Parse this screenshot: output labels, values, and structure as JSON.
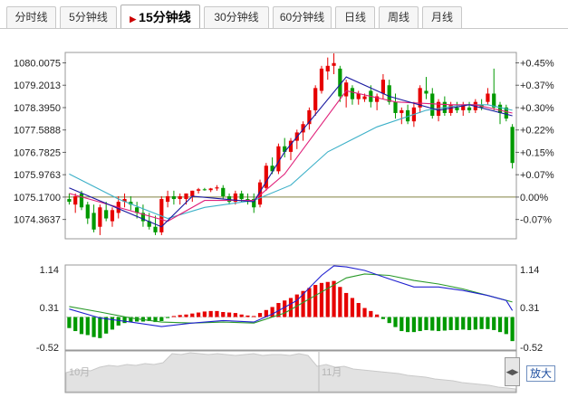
{
  "tabs": [
    {
      "label": "分时线",
      "active": false
    },
    {
      "label": "5分钟线",
      "active": false
    },
    {
      "label": "15分钟线",
      "active": true
    },
    {
      "label": "30分钟线",
      "active": false
    },
    {
      "label": "60分钟线",
      "active": false
    },
    {
      "label": "日线",
      "active": false
    },
    {
      "label": "周线",
      "active": false
    },
    {
      "label": "月线",
      "active": false
    }
  ],
  "zoom_label": "放大",
  "colors": {
    "up": "#e60000",
    "down": "#009900",
    "ma5": "#1a1aa0",
    "ma10": "#e0207a",
    "ma20": "#3cb0c8",
    "dif": "#2020d0",
    "dea": "#2a9a2a"
  },
  "chart_data": {
    "type": "candlestick",
    "price_axis": {
      "ylim": [
        1073.7,
        1080.35
      ],
      "left_ticks": [
        "1080.0075",
        "1079.2013",
        "1078.3950",
        "1077.5888",
        "1076.7825",
        "1075.9763",
        "1075.1700",
        "1074.3637"
      ],
      "right_ticks": [
        "+0.45%",
        "+0.37%",
        "+0.30%",
        "+0.22%",
        "+0.15%",
        "+0.07%",
        "0.00%",
        "-0.07%"
      ],
      "reference": 1075.17
    },
    "candles": [
      [
        1075.1,
        1075.3,
        1074.9,
        1075.0
      ],
      [
        1074.9,
        1075.3,
        1074.6,
        1075.2
      ],
      [
        1075.3,
        1075.4,
        1074.7,
        1074.8
      ],
      [
        1074.9,
        1075.0,
        1074.2,
        1074.4
      ],
      [
        1074.6,
        1074.9,
        1073.9,
        1074.0
      ],
      [
        1074.1,
        1074.9,
        1073.8,
        1074.8
      ],
      [
        1074.7,
        1075.0,
        1074.3,
        1074.4
      ],
      [
        1074.3,
        1074.8,
        1074.1,
        1074.7
      ],
      [
        1074.6,
        1075.2,
        1074.4,
        1075.0
      ],
      [
        1075.0,
        1075.3,
        1074.8,
        1075.1
      ],
      [
        1075.0,
        1075.2,
        1074.7,
        1074.9
      ],
      [
        1074.8,
        1075.0,
        1074.4,
        1074.6
      ],
      [
        1074.6,
        1074.9,
        1074.1,
        1074.3
      ],
      [
        1074.3,
        1074.6,
        1074.0,
        1074.1
      ],
      [
        1074.1,
        1074.5,
        1073.8,
        1073.9
      ],
      [
        1073.9,
        1075.2,
        1073.8,
        1075.1
      ],
      [
        1075.0,
        1075.4,
        1074.8,
        1075.2
      ],
      [
        1075.2,
        1075.4,
        1074.9,
        1075.1
      ],
      [
        1075.1,
        1075.3,
        1074.9,
        1075.2
      ],
      [
        1075.1,
        1075.3,
        1074.9,
        1075.3
      ],
      [
        1075.2,
        1075.4,
        1075.0,
        1075.4
      ],
      [
        1075.4,
        1075.5,
        1075.3,
        1075.45
      ],
      [
        1075.45,
        1075.5,
        1075.4,
        1075.42
      ],
      [
        1075.42,
        1075.5,
        1075.35,
        1075.48
      ],
      [
        1075.48,
        1075.6,
        1075.4,
        1075.52
      ],
      [
        1075.5,
        1075.6,
        1075.1,
        1075.2
      ],
      [
        1075.2,
        1075.3,
        1074.9,
        1075.0
      ],
      [
        1075.0,
        1075.4,
        1074.9,
        1075.3
      ],
      [
        1075.3,
        1075.4,
        1075.0,
        1075.1
      ],
      [
        1075.1,
        1075.3,
        1074.9,
        1075.0
      ],
      [
        1075.1,
        1075.3,
        1074.6,
        1074.8
      ],
      [
        1074.9,
        1075.8,
        1074.8,
        1075.7
      ],
      [
        1075.5,
        1076.4,
        1075.4,
        1076.3
      ],
      [
        1076.3,
        1076.6,
        1076.0,
        1076.1
      ],
      [
        1076.1,
        1077.1,
        1076.0,
        1077.0
      ],
      [
        1077.0,
        1077.3,
        1076.6,
        1076.8
      ],
      [
        1076.8,
        1077.3,
        1076.5,
        1077.2
      ],
      [
        1077.2,
        1077.6,
        1076.9,
        1077.5
      ],
      [
        1077.5,
        1077.9,
        1077.2,
        1077.8
      ],
      [
        1077.8,
        1078.4,
        1077.6,
        1078.3
      ],
      [
        1078.3,
        1079.2,
        1078.1,
        1079.1
      ],
      [
        1079.0,
        1079.9,
        1078.9,
        1079.8
      ],
      [
        1079.7,
        1080.2,
        1079.4,
        1079.9
      ],
      [
        1079.9,
        1080.35,
        1079.6,
        1080.0
      ],
      [
        1079.8,
        1079.9,
        1078.6,
        1078.8
      ],
      [
        1078.8,
        1079.4,
        1078.4,
        1079.3
      ],
      [
        1079.1,
        1079.2,
        1078.5,
        1078.7
      ],
      [
        1078.7,
        1079.0,
        1078.5,
        1078.9
      ],
      [
        1078.7,
        1078.9,
        1078.6,
        1078.8
      ],
      [
        1079.0,
        1079.2,
        1078.4,
        1078.6
      ],
      [
        1078.6,
        1078.9,
        1078.3,
        1078.8
      ],
      [
        1078.9,
        1079.6,
        1078.7,
        1079.4
      ],
      [
        1079.2,
        1079.4,
        1078.5,
        1078.6
      ],
      [
        1078.6,
        1078.9,
        1078.0,
        1078.2
      ],
      [
        1078.2,
        1078.4,
        1077.8,
        1078.3
      ],
      [
        1078.3,
        1078.5,
        1077.8,
        1077.9
      ],
      [
        1077.9,
        1078.6,
        1077.7,
        1078.4
      ],
      [
        1078.4,
        1079.2,
        1078.2,
        1079.1
      ],
      [
        1079.0,
        1079.5,
        1078.7,
        1078.9
      ],
      [
        1078.9,
        1079.1,
        1078.0,
        1078.1
      ],
      [
        1078.1,
        1078.7,
        1077.9,
        1078.6
      ],
      [
        1078.6,
        1078.8,
        1078.1,
        1078.2
      ],
      [
        1078.2,
        1078.6,
        1078.1,
        1078.5
      ],
      [
        1078.4,
        1078.6,
        1078.2,
        1078.3
      ],
      [
        1078.3,
        1078.6,
        1078.1,
        1078.5
      ],
      [
        1078.4,
        1078.6,
        1078.2,
        1078.3
      ],
      [
        1078.3,
        1078.7,
        1078.2,
        1078.6
      ],
      [
        1078.5,
        1078.7,
        1078.3,
        1078.4
      ],
      [
        1078.6,
        1079.1,
        1078.5,
        1078.9
      ],
      [
        1078.9,
        1079.8,
        1078.3,
        1078.4
      ],
      [
        1078.5,
        1078.6,
        1077.8,
        1078.2
      ],
      [
        1078.4,
        1078.5,
        1077.9,
        1078.0
      ],
      [
        1077.7,
        1077.8,
        1076.2,
        1076.4
      ]
    ],
    "ma": {
      "ma5": [
        [
          0,
          1075.5
        ],
        [
          15,
          1074.1
        ],
        [
          20,
          1075.2
        ],
        [
          30,
          1075.0
        ],
        [
          35,
          1076.8
        ],
        [
          45,
          1079.5
        ],
        [
          52,
          1078.8
        ],
        [
          60,
          1078.3
        ],
        [
          65,
          1078.5
        ],
        [
          72,
          1078.1
        ]
      ],
      "ma10": [
        [
          0,
          1075.3
        ],
        [
          16,
          1074.3
        ],
        [
          22,
          1075.05
        ],
        [
          30,
          1075.05
        ],
        [
          35,
          1076.0
        ],
        [
          45,
          1079.0
        ],
        [
          53,
          1078.6
        ],
        [
          62,
          1078.5
        ],
        [
          66,
          1078.5
        ],
        [
          72,
          1078.2
        ]
      ],
      "ma20": [
        [
          0,
          1076.0
        ],
        [
          8,
          1075.1
        ],
        [
          16,
          1074.4
        ],
        [
          22,
          1074.8
        ],
        [
          30,
          1075.05
        ],
        [
          36,
          1075.6
        ],
        [
          42,
          1076.8
        ],
        [
          50,
          1077.7
        ],
        [
          58,
          1078.3
        ],
        [
          64,
          1078.5
        ],
        [
          68,
          1078.5
        ],
        [
          72,
          1078.3
        ]
      ]
    },
    "macd": {
      "left_ticks": [
        "1.14",
        "0.31",
        "-0.52"
      ],
      "right_ticks": [
        "1.14",
        "0.31",
        "-0.52"
      ],
      "ylim": [
        -0.52,
        1.14
      ],
      "hist": [
        -0.22,
        -0.28,
        -0.34,
        -0.36,
        -0.4,
        -0.42,
        -0.33,
        -0.25,
        -0.17,
        -0.12,
        -0.1,
        -0.09,
        -0.09,
        -0.08,
        -0.1,
        -0.08,
        -0.02,
        0.02,
        0.04,
        0.05,
        0.07,
        0.09,
        0.11,
        0.12,
        0.12,
        0.1,
        0.09,
        0.08,
        0.05,
        0.03,
        0.02,
        0.08,
        0.14,
        0.2,
        0.28,
        0.33,
        0.38,
        0.45,
        0.52,
        0.58,
        0.64,
        0.68,
        0.7,
        0.72,
        0.6,
        0.48,
        0.38,
        0.28,
        0.18,
        0.12,
        0.05,
        -0.04,
        -0.12,
        -0.2,
        -0.28,
        -0.3,
        -0.3,
        -0.28,
        -0.26,
        -0.27,
        -0.28,
        -0.27,
        -0.26,
        -0.26,
        -0.25,
        -0.26,
        -0.25,
        -0.24,
        -0.24,
        -0.26,
        -0.3,
        -0.34,
        -0.48
      ],
      "dif": [
        [
          0,
          0.28
        ],
        [
          5,
          0.1
        ],
        [
          10,
          0.02
        ],
        [
          15,
          -0.07
        ],
        [
          20,
          0.0
        ],
        [
          25,
          0.05
        ],
        [
          30,
          0.02
        ],
        [
          33,
          0.18
        ],
        [
          37,
          0.45
        ],
        [
          41,
          0.95
        ],
        [
          43,
          1.14
        ],
        [
          45,
          1.12
        ],
        [
          48,
          1.05
        ],
        [
          52,
          0.88
        ],
        [
          56,
          0.72
        ],
        [
          60,
          0.72
        ],
        [
          64,
          0.65
        ],
        [
          68,
          0.55
        ],
        [
          71,
          0.45
        ],
        [
          72,
          0.25
        ]
      ],
      "dea": [
        [
          0,
          0.33
        ],
        [
          5,
          0.22
        ],
        [
          10,
          0.1
        ],
        [
          15,
          0.02
        ],
        [
          20,
          0.0
        ],
        [
          25,
          0.02
        ],
        [
          30,
          0.0
        ],
        [
          35,
          0.2
        ],
        [
          40,
          0.55
        ],
        [
          45,
          0.9
        ],
        [
          48,
          0.98
        ],
        [
          52,
          0.95
        ],
        [
          56,
          0.85
        ],
        [
          60,
          0.78
        ],
        [
          64,
          0.68
        ],
        [
          68,
          0.55
        ],
        [
          72,
          0.42
        ]
      ]
    },
    "navigator": {
      "labels": [
        "10月",
        "11月"
      ]
    }
  }
}
